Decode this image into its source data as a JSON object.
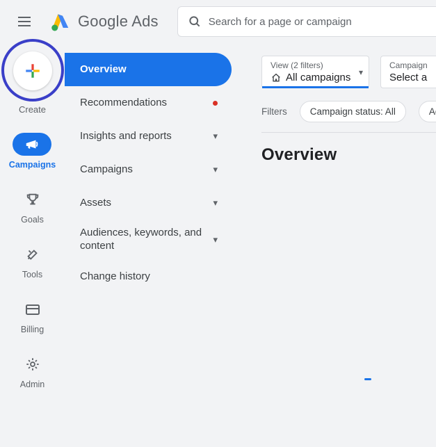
{
  "header": {
    "product_name": "Google Ads",
    "search_placeholder": "Search for a page or campaign"
  },
  "leftrail": {
    "create_label": "Create",
    "items": [
      {
        "label": "Campaigns",
        "active": true
      },
      {
        "label": "Goals",
        "active": false
      },
      {
        "label": "Tools",
        "active": false
      },
      {
        "label": "Billing",
        "active": false
      },
      {
        "label": "Admin",
        "active": false
      }
    ]
  },
  "midnav": {
    "items": [
      {
        "label": "Overview",
        "active": true,
        "has_dot": false,
        "has_chevron": false
      },
      {
        "label": "Recommendations",
        "active": false,
        "has_dot": true,
        "has_chevron": false
      },
      {
        "label": "Insights and reports",
        "active": false,
        "has_dot": false,
        "has_chevron": true
      },
      {
        "label": "Campaigns",
        "active": false,
        "has_dot": false,
        "has_chevron": true
      },
      {
        "label": "Assets",
        "active": false,
        "has_dot": false,
        "has_chevron": true
      },
      {
        "label": "Audiences, keywords, and content",
        "active": false,
        "has_dot": false,
        "has_chevron": true
      },
      {
        "label": "Change history",
        "active": false,
        "has_dot": false,
        "has_chevron": false
      }
    ]
  },
  "main": {
    "view_card": {
      "small": "View (2 filters)",
      "value": "All campaigns"
    },
    "campaign_card": {
      "small": "Campaign",
      "value": "Select a"
    },
    "filters_label": "Filters",
    "chips": [
      "Campaign status: All",
      "Ad g"
    ],
    "page_title": "Overview"
  }
}
